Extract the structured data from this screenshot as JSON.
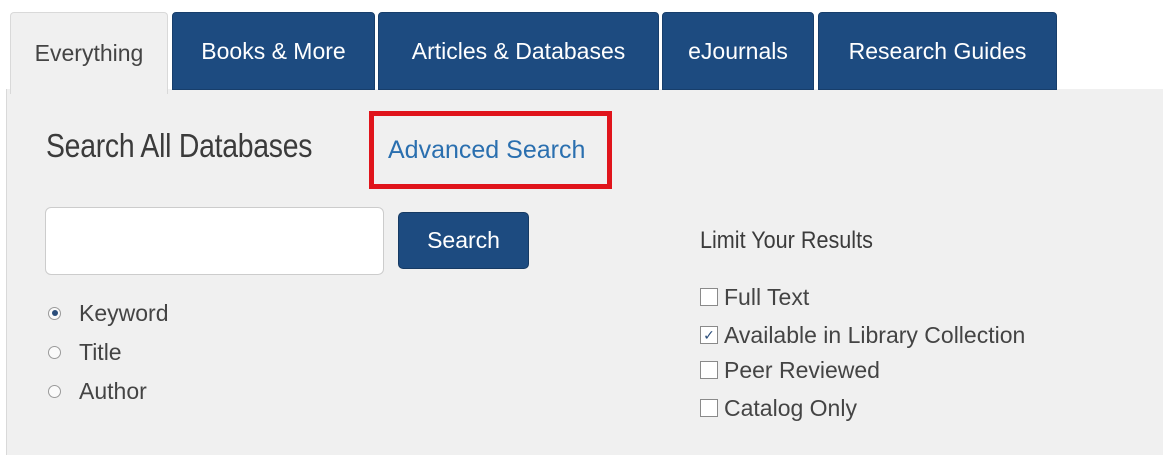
{
  "tabs": [
    {
      "label": "Everything",
      "active": true
    },
    {
      "label": "Books & More",
      "active": false
    },
    {
      "label": "Articles & Databases",
      "active": false
    },
    {
      "label": "eJournals",
      "active": false
    },
    {
      "label": "Research Guides",
      "active": false
    }
  ],
  "search": {
    "heading": "Search All Databases",
    "advanced_link": "Advanced Search",
    "input_value": "",
    "input_placeholder": "",
    "button_label": "Search",
    "search_by": {
      "options": [
        {
          "label": "Keyword",
          "selected": true
        },
        {
          "label": "Title",
          "selected": false
        },
        {
          "label": "Author",
          "selected": false
        }
      ]
    }
  },
  "limits": {
    "title": "Limit Your Results",
    "options": [
      {
        "label": "Full Text",
        "checked": false
      },
      {
        "label": "Available in Library Collection",
        "checked": true
      },
      {
        "label": "Peer Reviewed",
        "checked": false
      },
      {
        "label": "Catalog Only",
        "checked": false
      }
    ]
  },
  "colors": {
    "tab_active_bg": "#f0f0f0",
    "tab_inactive_bg": "#1d4b80",
    "panel_bg": "#f0f0f0",
    "link": "#2a6faf",
    "highlight_box": "#e0141b",
    "button_bg": "#1d4b80"
  },
  "icons": {
    "radio_selected": "radio-selected-icon",
    "checkbox_checked": "check-icon"
  }
}
